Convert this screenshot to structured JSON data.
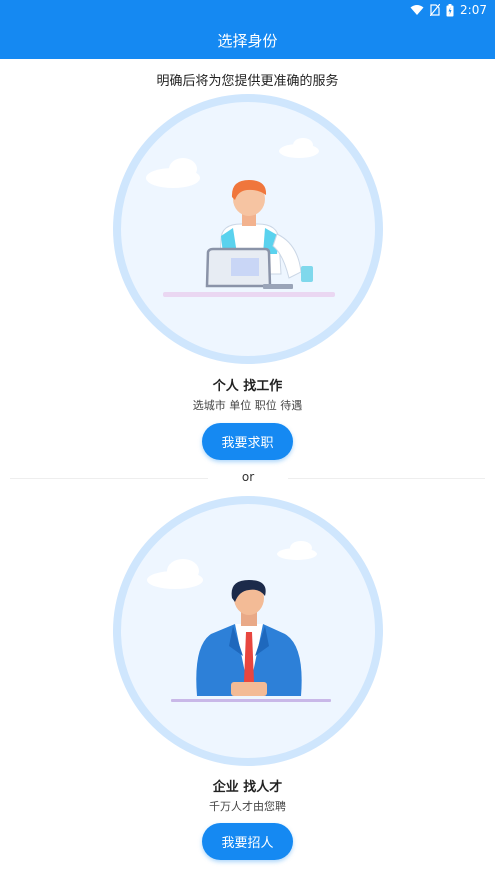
{
  "status_bar": {
    "time": "2:07"
  },
  "header": {
    "title": "选择身份"
  },
  "subtitle": "明确后将为您提供更准确的服务",
  "job_seeker": {
    "title": "个人 找工作",
    "desc": "选城市 单位 职位 待遇",
    "button": "我要求职"
  },
  "divider_text": "or",
  "employer": {
    "title": "企业 找人才",
    "desc": "千万人才由您聘",
    "button": "我要招人"
  },
  "colors": {
    "primary": "#1589f2",
    "circle_ring": "#cfe6fd",
    "circle_fill": "#eef6ff"
  }
}
